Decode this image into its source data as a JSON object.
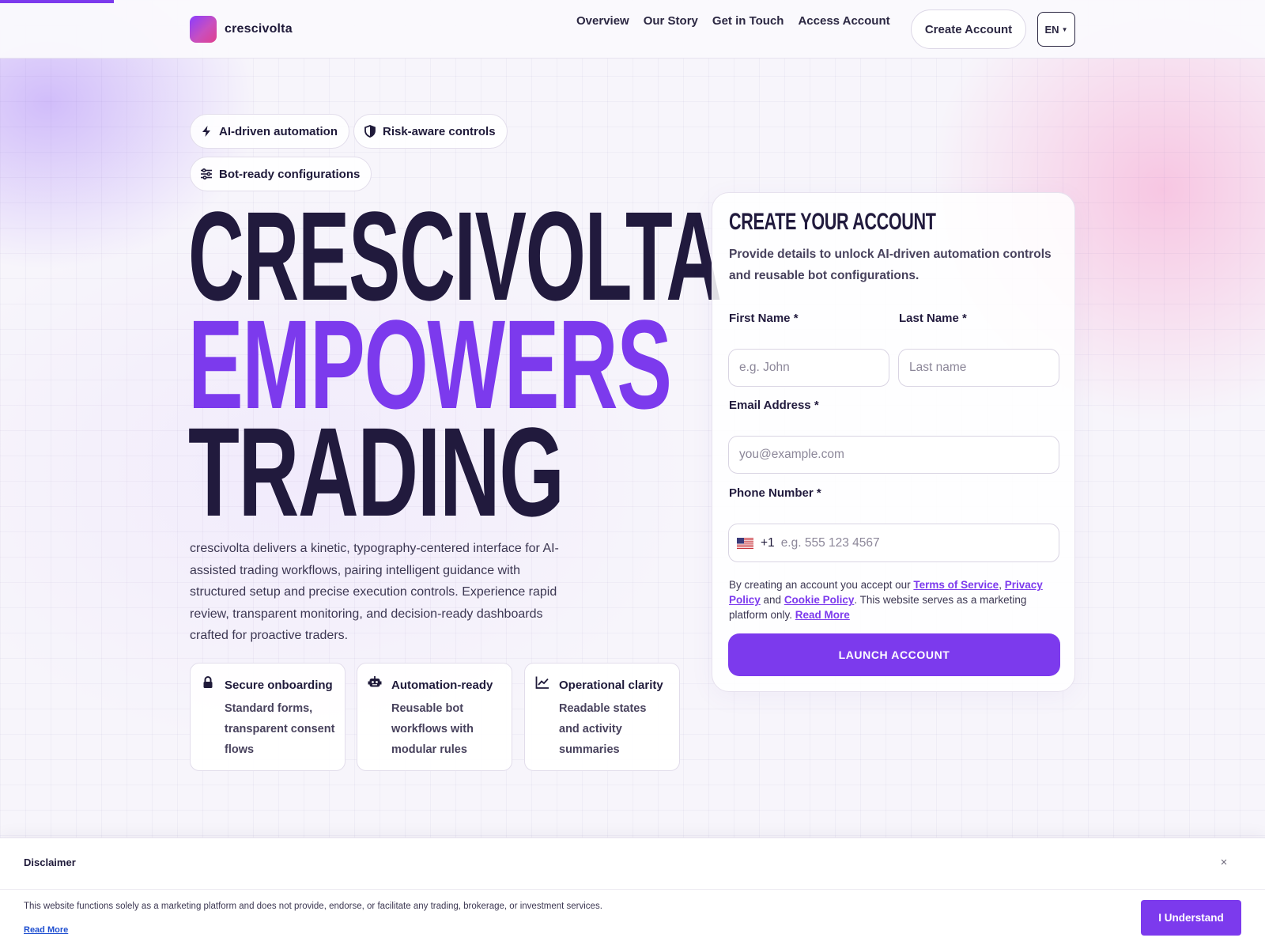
{
  "brand": {
    "name": "crescivolta"
  },
  "nav": {
    "items": [
      {
        "label": "Overview"
      },
      {
        "label": "Our Story"
      },
      {
        "label": "Get in Touch"
      },
      {
        "label": "Access Account"
      }
    ],
    "create_account_label": "Create Account",
    "language": "EN"
  },
  "chips": [
    {
      "label": "AI-driven automation",
      "icon": "bolt-icon"
    },
    {
      "label": "Risk-aware controls",
      "icon": "shield-icon"
    },
    {
      "label": "Bot-ready configurations",
      "icon": "sliders-icon"
    }
  ],
  "hero": {
    "line1": "CRESCIVOLTA",
    "line2": "EMPOWERS",
    "line3": "TRADING",
    "description": "crescivolta delivers a kinetic, typography-centered interface for AI-assisted trading workflows, pairing intelligent guidance with structured setup and precise execution controls. Experience rapid review, transparent monitoring, and decision-ready dashboards crafted for proactive traders."
  },
  "features": [
    {
      "title": "Secure onboarding",
      "description": "Standard forms, transparent consent flows",
      "icon": "lock-icon"
    },
    {
      "title": "Automation-ready",
      "description": "Reusable bot workflows with modular rules",
      "icon": "robot-icon"
    },
    {
      "title": "Operational clarity",
      "description": "Readable states and activity summaries",
      "icon": "chart-line-icon"
    }
  ],
  "form": {
    "title": "CREATE YOUR ACCOUNT",
    "subtitle": "Provide details to unlock AI-driven automation controls and reusable bot configurations.",
    "first_name": {
      "label": "First Name *",
      "placeholder": "e.g. John",
      "value": ""
    },
    "last_name": {
      "label": "Last Name *",
      "placeholder": "Last name",
      "value": ""
    },
    "email": {
      "label": "Email Address *",
      "placeholder": "you@example.com",
      "value": ""
    },
    "phone": {
      "label": "Phone Number *",
      "dial_code": "+1",
      "flag": "us-flag-icon",
      "placeholder": "e.g. 555 123 4567",
      "value": ""
    },
    "consent": {
      "prefix": "By creating an account you accept our ",
      "terms": "Terms of Service",
      "comma": ", ",
      "privacy": "Privacy Policy",
      "and": " and ",
      "cookie": "Cookie Policy",
      "suffix": ". This website serves as a marketing platform only. ",
      "read_more": "Read More"
    },
    "submit_label": "LAUNCH ACCOUNT"
  },
  "disclaimer": {
    "title": "Disclaimer",
    "text": "This website functions solely as a marketing platform and does not provide, endorse, or facilitate any trading, brokerage, or investment services.",
    "read_more": "Read More",
    "button_label": "I Understand",
    "close_symbol": "×"
  },
  "colors": {
    "accent": "#7c3aed",
    "ink": "#211a3d",
    "link": "#1f4fd0"
  }
}
